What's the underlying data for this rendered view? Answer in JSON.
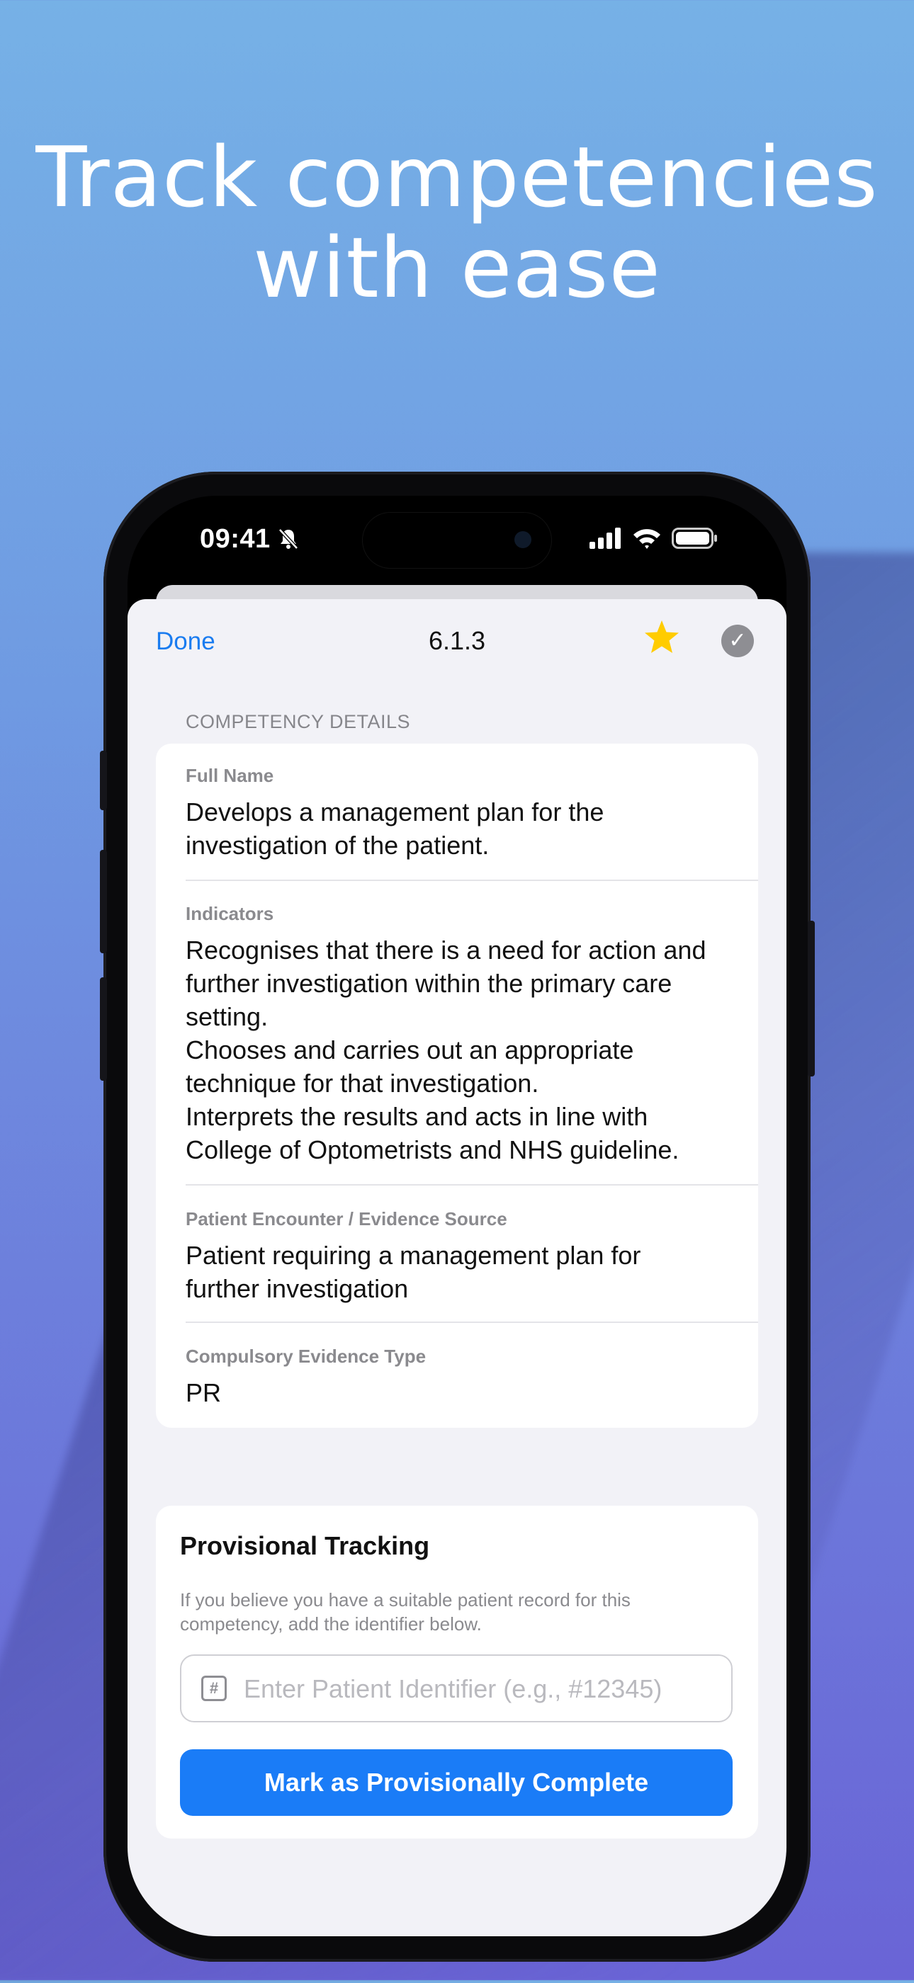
{
  "headline": {
    "line1": "Track competencies",
    "line2": "with ease"
  },
  "status_bar": {
    "time": "09:41"
  },
  "nav": {
    "done_label": "Done",
    "title": "6.1.3",
    "check_glyph": "✓"
  },
  "section_header": "COMPETENCY DETAILS",
  "details": {
    "full_name_label": "Full Name",
    "full_name": "Develops a management plan for the\ninvestigation of the patient.",
    "indicators_label": "Indicators",
    "indicators": "Recognises that there is a need for action and\nfurther investigation within the primary care\nsetting.\nChooses and carries out an appropriate\ntechnique for that investigation.\nInterprets the results and acts in line with\nCollege of Optometrists and NHS guideline.",
    "encounter_label": "Patient Encounter / Evidence Source",
    "encounter": "Patient requiring a management plan for\nfurther investigation",
    "evidence_type_label": "Compulsory Evidence Type",
    "evidence_type": "PR"
  },
  "tracking": {
    "title": "Provisional Tracking",
    "description": "If you believe you have a suitable patient record for this competency, add the identifier below.",
    "input_placeholder": "Enter Patient Identifier (e.g., #12345)",
    "hash_glyph": "#",
    "button_label": "Mark as Provisionally Complete"
  },
  "colors": {
    "accent": "#1a7cf7",
    "star": "#ffcc00",
    "sheet_bg": "#f2f2f7"
  },
  "icons": [
    "muted-bell-icon",
    "signal-icon",
    "wifi-icon",
    "battery-icon",
    "star-icon",
    "checkmark-icon",
    "hash-icon"
  ]
}
